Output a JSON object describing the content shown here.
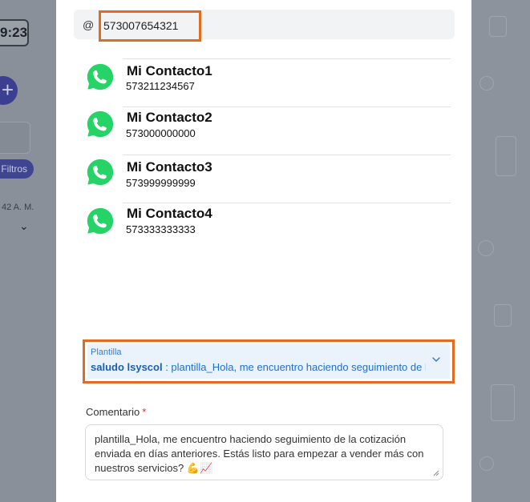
{
  "backdrop": {
    "time": "9:23",
    "plus": "+",
    "filters_label": "Filtros",
    "timestamp": "42 A. M.",
    "chevron": "⌄"
  },
  "search": {
    "at_symbol": "@",
    "value": "573007654321"
  },
  "contacts": [
    {
      "name": "Mi Contacto1",
      "phone": "573211234567",
      "icon": "whatsapp-icon"
    },
    {
      "name": "Mi Contacto2",
      "phone": "573000000000",
      "icon": "whatsapp-icon"
    },
    {
      "name": "Mi Contacto3",
      "phone": "573999999999",
      "icon": "whatsapp-icon"
    },
    {
      "name": "Mi Contacto4",
      "phone": "573333333333",
      "icon": "whatsapp-icon"
    }
  ],
  "template": {
    "label": "Plantilla",
    "name": "saludo lsyscol",
    "value": " : plantilla_Hola, me encuentro haciendo seguimiento de la cotización"
  },
  "comment": {
    "label": "Comentario",
    "required": "*",
    "text": "plantilla_Hola, me encuentro haciendo seguimiento de la cotización enviada en días anteriores. Estás listo para empezar a vender más con nuestros servicios? 💪📈"
  },
  "colors": {
    "highlight": "#e46a1f",
    "whatsapp": "#25d366",
    "accent": "#1f6fd1"
  }
}
